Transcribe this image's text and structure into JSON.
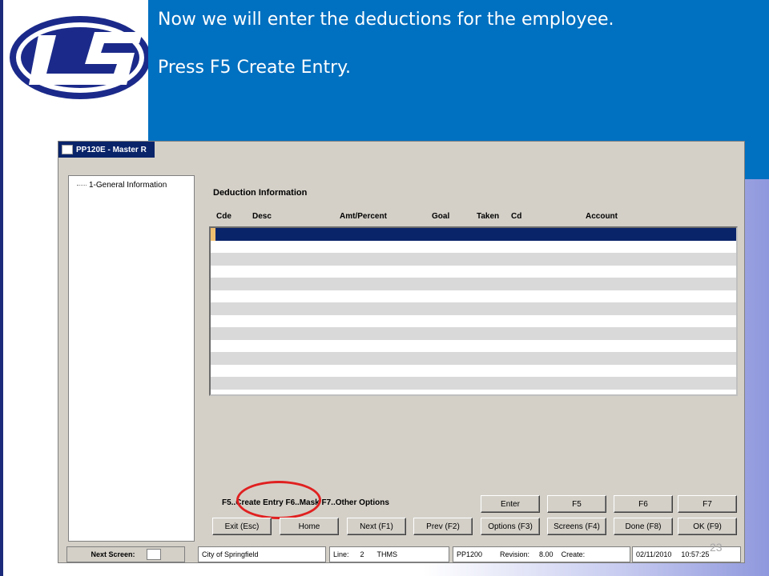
{
  "callout": {
    "line1": "Now we will enter the deductions for the employee.",
    "line2": "Press F5 Create Entry."
  },
  "window": {
    "title": "PP120E - Master R",
    "tree": {
      "items": [
        {
          "label": "1-General Information"
        }
      ]
    },
    "section_title": "Deduction Information",
    "columns": [
      "Cde",
      "Desc",
      "Amt/Percent",
      "Goal",
      "Taken",
      "Cd",
      "Account"
    ],
    "hotkeys": "F5..Create Entry  F6..Mask  F7..Other Options",
    "buttons": {
      "enter": "Enter",
      "f5": "F5",
      "f6": "F6",
      "f7": "F7",
      "exit": "Exit (Esc)",
      "home": "Home",
      "next": "Next (F1)",
      "prev": "Prev (F2)",
      "options": "Options (F3)",
      "screens": "Screens (F4)",
      "done": "Done (F8)",
      "ok": "OK (F9)"
    },
    "status": {
      "next_screen_label": "Next Screen:",
      "org": "City of Springfield",
      "line_label": "Line:",
      "line_value": "2",
      "user": "THMS",
      "program": "PP1200",
      "revision_label": "Revision:",
      "revision_value": "8.00",
      "create_label": "Create:",
      "date": "02/11/2010",
      "time": "10:57:25"
    }
  },
  "page_number": "23",
  "colors": {
    "callout_bg": "#0070c0",
    "selected_row": "#0a246a",
    "highlight_circle": "#e02020"
  }
}
